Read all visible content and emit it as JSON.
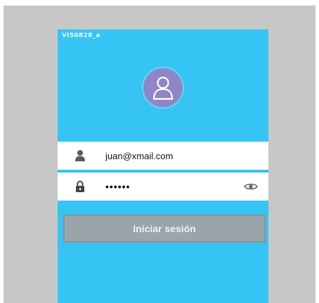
{
  "app": {
    "id_label": "VI50828_a"
  },
  "login": {
    "username_value": "juan@xmail.com",
    "password_value": "••••••",
    "submit_label": "Iniciar sesión"
  },
  "icons": {
    "avatar": "user-avatar-icon",
    "user": "person-icon",
    "lock": "padlock-icon",
    "toggle": "eye-icon"
  },
  "colors": {
    "background": "#36c4f4",
    "avatar": "#8e86c7",
    "button": "#9aa4aa",
    "frame": "#c7c7c7"
  }
}
